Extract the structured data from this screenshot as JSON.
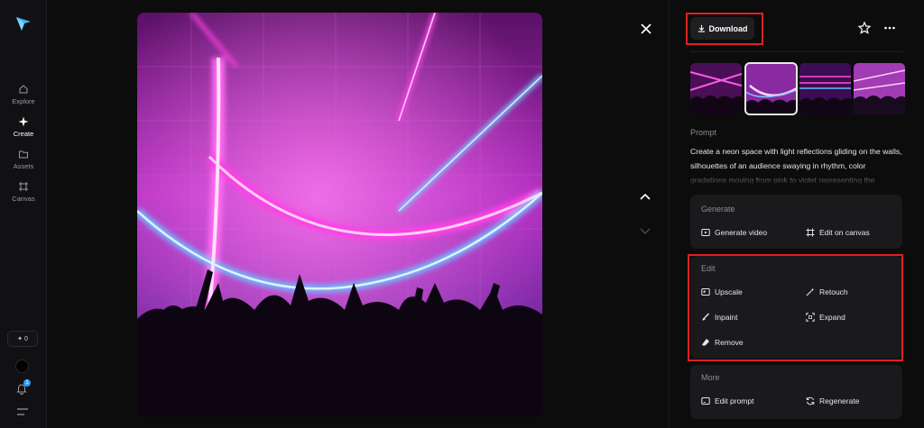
{
  "sidebar": {
    "items": [
      {
        "label": "Explore",
        "icon": "home-icon"
      },
      {
        "label": "Create",
        "icon": "sparkle-icon"
      },
      {
        "label": "Assets",
        "icon": "folder-icon"
      },
      {
        "label": "Canvas",
        "icon": "canvas-icon"
      }
    ],
    "credits": "0",
    "notification_count": "1"
  },
  "header": {
    "download_label": "Download"
  },
  "prompt": {
    "label": "Prompt",
    "text": "Create a neon space with light reflections gliding on the walls, silhouettes of an audience swaying in rhythm, color gradations moving from pink to violet representing the"
  },
  "sections": {
    "generate": {
      "title": "Generate",
      "actions": [
        "Generate video",
        "Edit on canvas"
      ]
    },
    "edit": {
      "title": "Edit",
      "actions": [
        "Upscale",
        "Retouch",
        "Inpaint",
        "Expand",
        "Remove"
      ]
    },
    "more": {
      "title": "More",
      "actions": [
        "Edit prompt",
        "Regenerate"
      ]
    }
  },
  "colors": {
    "accent_pink": "#ff2bd6",
    "accent_blue": "#4fb3ff",
    "highlight_red": "#e02020"
  }
}
